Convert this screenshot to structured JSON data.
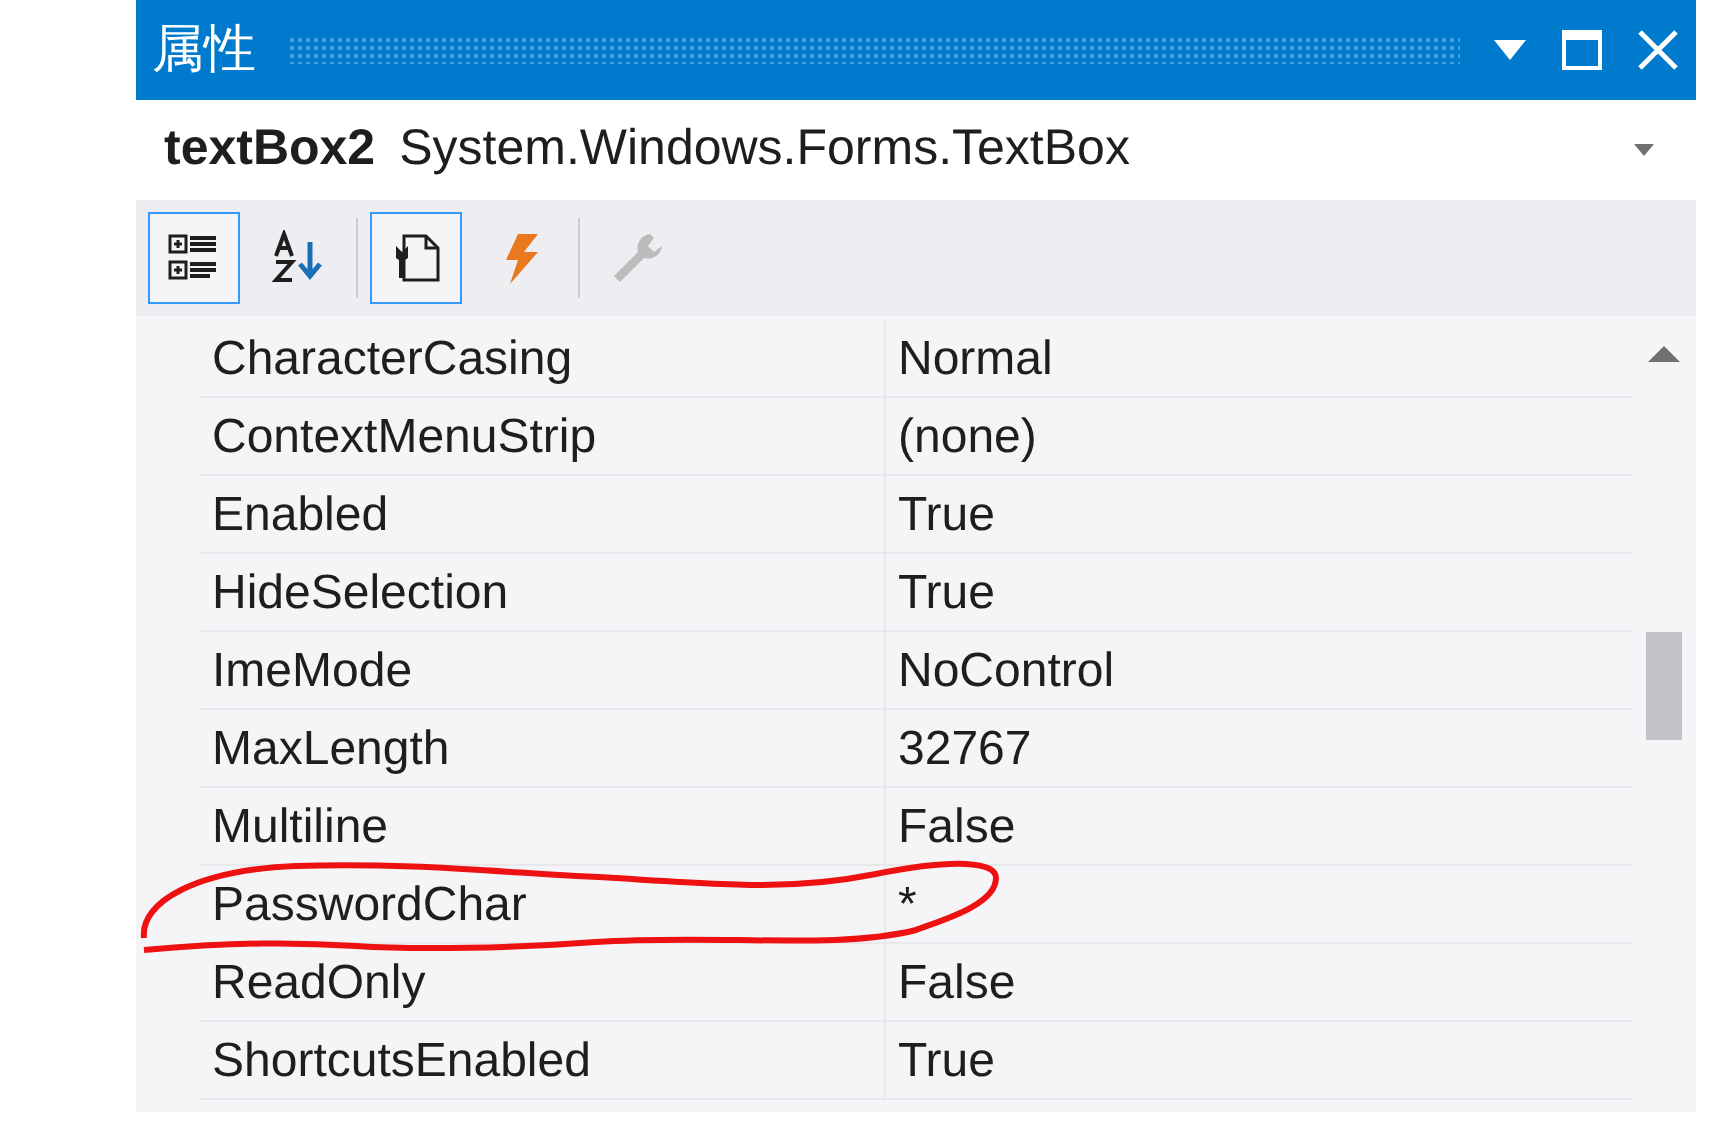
{
  "window": {
    "title": "属性"
  },
  "object": {
    "name": "textBox2",
    "type": "System.Windows.Forms.TextBox"
  },
  "toolbar": [
    {
      "kind": "categorized",
      "selected": true,
      "disabled": false
    },
    {
      "kind": "alphabetical",
      "selected": false,
      "disabled": false
    },
    {
      "kind": "separator"
    },
    {
      "kind": "properties",
      "selected": true,
      "disabled": false
    },
    {
      "kind": "events",
      "selected": false,
      "disabled": false
    },
    {
      "kind": "separator"
    },
    {
      "kind": "pages",
      "selected": false,
      "disabled": true
    }
  ],
  "properties": [
    {
      "name": "CharacterCasing",
      "value": "Normal",
      "annotated": false
    },
    {
      "name": "ContextMenuStrip",
      "value": "(none)",
      "annotated": false
    },
    {
      "name": "Enabled",
      "value": "True",
      "annotated": false
    },
    {
      "name": "HideSelection",
      "value": "True",
      "annotated": false
    },
    {
      "name": "ImeMode",
      "value": "NoControl",
      "annotated": false
    },
    {
      "name": "MaxLength",
      "value": "32767",
      "annotated": false
    },
    {
      "name": "Multiline",
      "value": "False",
      "annotated": false
    },
    {
      "name": "PasswordChar",
      "value": "*",
      "annotated": true
    },
    {
      "name": "ReadOnly",
      "value": "False",
      "annotated": false
    },
    {
      "name": "ShortcutsEnabled",
      "value": "True",
      "annotated": false
    }
  ]
}
